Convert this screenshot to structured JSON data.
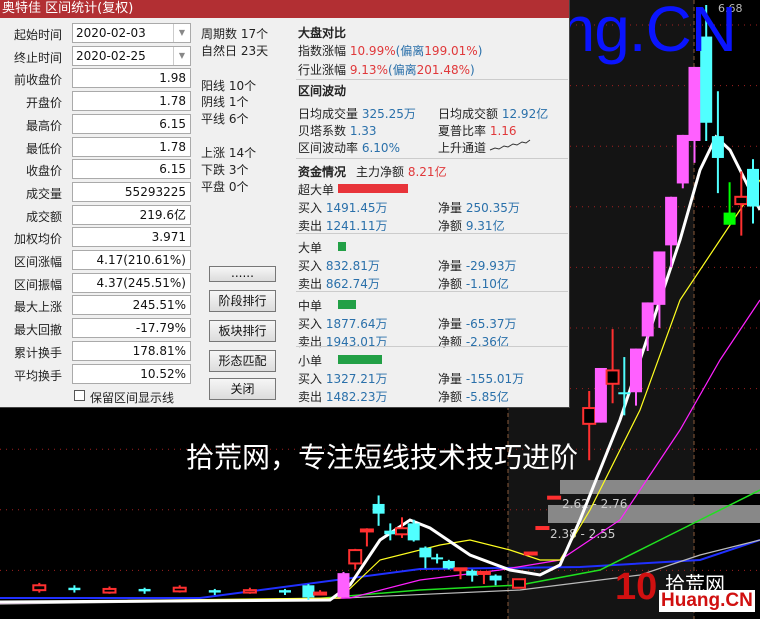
{
  "window": {
    "title": "奥特佳 区间统计(复权)"
  },
  "fields": [
    {
      "label": "起始时间",
      "value": "2020-02-03",
      "type": "combo"
    },
    {
      "label": "终止时间",
      "value": "2020-02-25",
      "type": "combo"
    },
    {
      "label": "前收盘价",
      "value": "1.98"
    },
    {
      "label": "开盘价",
      "value": "1.78"
    },
    {
      "label": "最高价",
      "value": "6.15"
    },
    {
      "label": "最低价",
      "value": "1.78"
    },
    {
      "label": "收盘价",
      "value": "6.15"
    },
    {
      "label": "成交量",
      "value": "55293225"
    },
    {
      "label": "成交额",
      "value": "219.6亿"
    },
    {
      "label": "加权均价",
      "value": "3.971"
    },
    {
      "label": "区间涨幅",
      "value": "4.17(210.61%)"
    },
    {
      "label": "区间振幅",
      "value": "4.37(245.51%)"
    },
    {
      "label": "最大上涨",
      "value": "245.51%"
    },
    {
      "label": "最大回撤",
      "value": "-17.79%"
    },
    {
      "label": "累计换手",
      "value": "178.81%"
    },
    {
      "label": "平均换手",
      "value": "10.52%"
    }
  ],
  "checkbox": {
    "label": "保留区间显示线",
    "checked": false
  },
  "counts": {
    "period": "周期数 17个",
    "natural_days": "自然日 23天",
    "yang": "阳线 10个",
    "yin": "阴线 1个",
    "flat_line": "平线 6个",
    "up": "上涨 14个",
    "down": "下跌 3个",
    "flat": "平盘 0个"
  },
  "buttons": [
    "......",
    "阶段排行",
    "板块排行",
    "形态匹配",
    "关闭"
  ],
  "market": {
    "title": "大盘对比",
    "index_label": "指数涨幅",
    "index_value": "10.99%",
    "index_dev_label": "(偏离",
    "index_dev_value": "199.01%",
    "close_paren": ")",
    "industry_label": "行业涨幅",
    "industry_value": "9.13%",
    "industry_dev_label": "(偏离",
    "industry_dev_value": "201.48%"
  },
  "volatility": {
    "title": "区间波动",
    "avg_vol_label": "日均成交量",
    "avg_vol": "325.25万",
    "avg_amt_label": "日均成交额",
    "avg_amt": "12.92亿",
    "beta_label": "贝塔系数",
    "beta": "1.33",
    "sharpe_label": "夏普比率",
    "sharpe": "1.16",
    "vol_rate_label": "区间波动率",
    "vol_rate": "6.10%",
    "channel_label": "上升通道"
  },
  "funds": {
    "title": "资金情况",
    "main_label": "主力净额",
    "main_value": "8.21亿",
    "groups": [
      {
        "name": "超大单",
        "buy": "1491.45万",
        "sell": "1241.11万",
        "net_vol": "250.35万",
        "net_amt": "9.31亿",
        "color": "#e8343a",
        "share": 0.7
      },
      {
        "name": "大单",
        "buy": "832.81万",
        "sell": "862.74万",
        "net_vol": "-29.93万",
        "net_amt": "-1.10亿",
        "color": "#22a046",
        "share": 0.08
      },
      {
        "name": "中单",
        "buy": "1877.64万",
        "sell": "1943.01万",
        "net_vol": "-65.37万",
        "net_amt": "-2.36亿",
        "color": "#22a046",
        "share": 0.18
      },
      {
        "name": "小单",
        "buy": "1327.21万",
        "sell": "1482.23万",
        "net_vol": "-155.01万",
        "net_amt": "-5.85亿",
        "color": "#22a046",
        "share": 0.44
      }
    ],
    "buy_label": "买入",
    "sell_label": "卖出",
    "net_vol_label": "净量",
    "net_amt_label": "净额"
  },
  "chart": {
    "high_label": "6.68",
    "zone1": "2.62 - 2.76",
    "zone2": "2.38 - 2.55",
    "kline": [
      [
        3,
        1.86,
        1.9,
        1.92,
        1.84
      ],
      [
        6,
        1.88,
        1.86,
        1.9,
        1.84
      ],
      [
        9,
        1.84,
        1.87,
        1.89,
        1.83
      ],
      [
        12,
        1.87,
        1.85,
        1.88,
        1.83
      ],
      [
        15,
        1.85,
        1.88,
        1.9,
        1.84
      ],
      [
        18,
        1.86,
        1.84,
        1.87,
        1.82
      ],
      [
        21,
        1.84,
        1.86,
        1.88,
        1.83
      ],
      [
        24,
        1.86,
        1.84,
        1.87,
        1.82
      ],
      [
        26,
        1.9,
        1.8,
        1.91,
        1.78
      ],
      [
        27,
        1.83,
        1.84,
        1.86,
        1.82
      ],
      [
        29,
        1.8,
        2.0,
        2.01,
        1.8
      ],
      [
        30,
        2.08,
        2.19,
        2.2,
        2.03
      ],
      [
        31,
        2.35,
        2.36,
        2.37,
        2.22
      ],
      [
        32,
        2.57,
        2.49,
        2.64,
        2.39
      ],
      [
        33,
        2.35,
        2.32,
        2.41,
        2.27
      ],
      [
        34,
        2.32,
        2.37,
        2.46,
        2.29
      ],
      [
        35,
        2.41,
        2.27,
        2.44,
        2.26
      ],
      [
        36,
        2.21,
        2.13,
        2.22,
        2.04
      ],
      [
        37,
        2.13,
        2.12,
        2.16,
        2.08
      ],
      [
        38,
        2.1,
        2.04,
        2.11,
        2.03
      ],
      [
        39,
        2.03,
        2.04,
        2.04,
        1.95
      ],
      [
        40,
        2.02,
        1.98,
        2.03,
        1.93
      ],
      [
        41,
        2.0,
        2.01,
        2.01,
        1.91
      ],
      [
        42,
        1.98,
        1.94,
        1.99,
        1.9
      ],
      [
        44,
        1.88,
        1.95,
        1.95,
        1.88
      ],
      [
        45,
        2.16,
        2.17,
        2.17,
        2.16
      ],
      [
        46,
        2.37,
        2.38,
        2.38,
        2.37
      ],
      [
        47,
        2.62,
        2.63,
        2.63,
        2.62
      ],
      [
        50,
        3.23,
        3.36,
        3.5,
        2.93
      ],
      [
        51,
        3.24,
        3.69,
        3.69,
        3.24
      ],
      [
        52,
        3.56,
        3.67,
        4.01,
        3.4
      ],
      [
        53,
        3.49,
        3.48,
        3.78,
        3.3
      ],
      [
        54,
        3.49,
        3.85,
        3.85,
        3.38
      ],
      [
        55,
        3.95,
        4.23,
        4.23,
        3.83
      ],
      [
        56,
        4.21,
        4.65,
        4.65,
        4.02
      ],
      [
        57,
        4.7,
        5.1,
        5.1,
        4.52
      ],
      [
        58,
        5.21,
        5.61,
        5.61,
        5.17
      ],
      [
        59,
        5.56,
        6.17,
        6.17,
        5.38
      ],
      [
        60,
        6.42,
        5.71,
        6.68,
        5.56
      ],
      [
        61,
        5.6,
        5.42,
        5.97,
        5.13
      ],
      [
        62,
        4.97,
        4.87,
        5.22,
        4.87
      ],
      [
        63,
        5.04,
        5.1,
        5.31,
        4.78
      ],
      [
        64,
        5.33,
        5.02,
        5.41,
        4.88
      ]
    ]
  },
  "overlay": {
    "watermark": "10Huang.CN",
    "caption": "拾荒网，专注短线技术技巧进阶",
    "logo_num": "10",
    "logo_cn": "拾荒网",
    "logo_en": "Huang.CN"
  }
}
